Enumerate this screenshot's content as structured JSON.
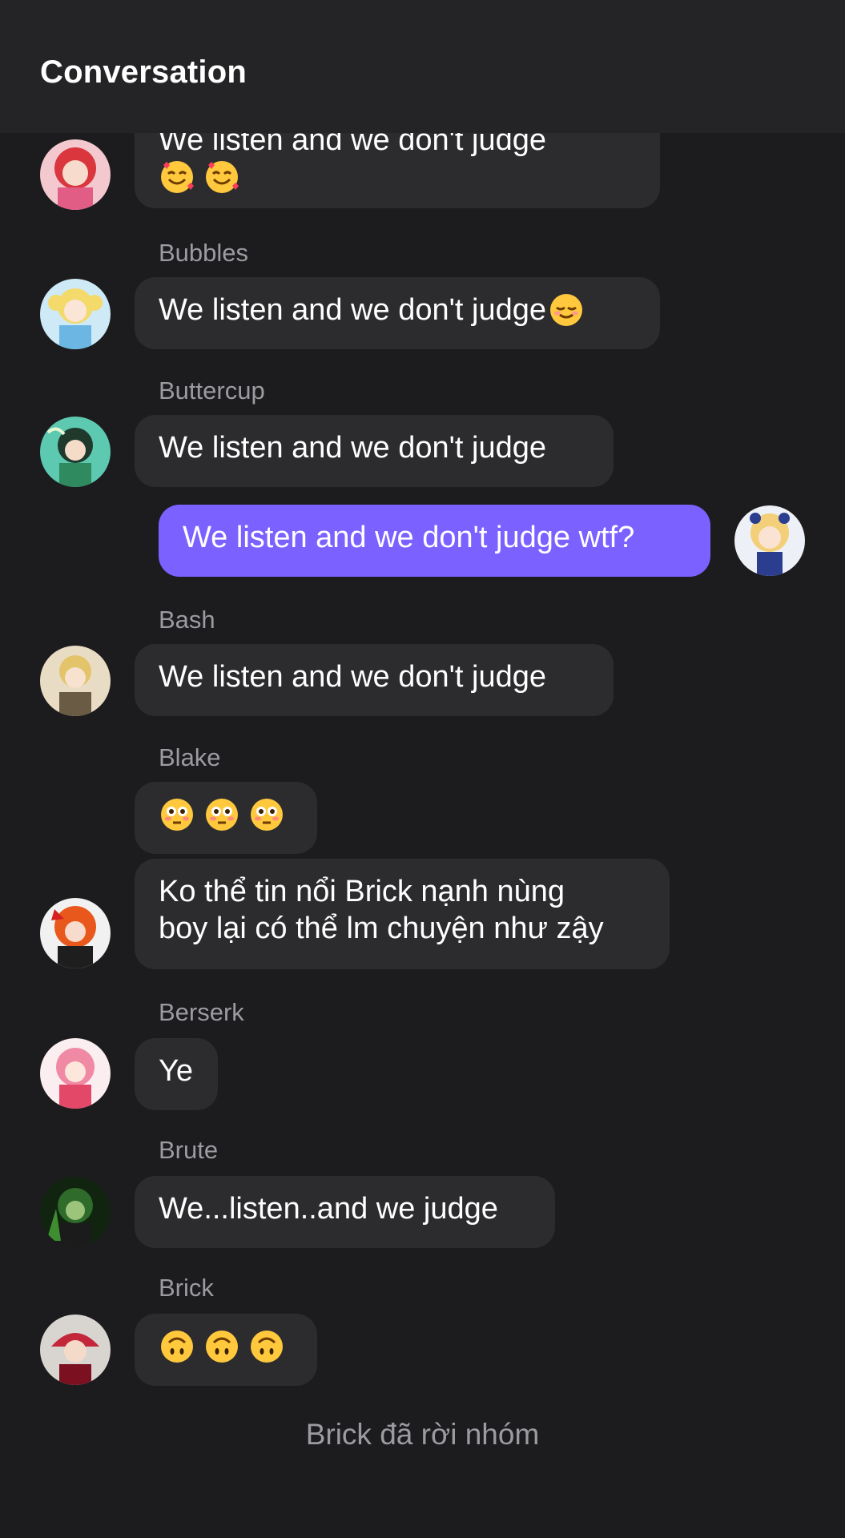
{
  "header": {
    "title": "Conversation"
  },
  "messages": [
    {
      "sender": "",
      "text": "We listen and we don't judge",
      "emoji_line": [
        "smiling-hearts",
        "smiling-hearts"
      ],
      "side": "left"
    },
    {
      "sender": "Bubbles",
      "text": "We listen and we don't judge",
      "trailing_emoji": "relieved-smile",
      "side": "left"
    },
    {
      "sender": "Buttercup",
      "text": "We listen and we don't judge",
      "side": "left"
    },
    {
      "sender": "",
      "text": "We listen and we don't judge wtf?",
      "side": "right"
    },
    {
      "sender": "Bash",
      "text": "We listen and we don't judge",
      "side": "left"
    },
    {
      "sender": "Blake",
      "text": "",
      "emojis": [
        "flushed",
        "flushed",
        "flushed"
      ],
      "side": "left"
    },
    {
      "sender": "",
      "line1": "Ko thể tin nổi Brick nạnh nùng",
      "line2": "boy lại có thể lm chuyện như zậy",
      "side": "left"
    },
    {
      "sender": "Berserk",
      "text": "Ye",
      "side": "left"
    },
    {
      "sender": "Brute",
      "text": "We...listen..and we judge",
      "side": "left"
    },
    {
      "sender": "Brick",
      "text": "",
      "emojis": [
        "upside-down",
        "upside-down",
        "upside-down"
      ],
      "side": "left"
    }
  ],
  "system_message": "Brick đã rời nhóm",
  "colors": {
    "background": "#1c1c1e",
    "header": "#242426",
    "bubble": "#2c2c2e",
    "my_bubble": "#7b61ff",
    "sender_name": "#9b9ba1"
  }
}
